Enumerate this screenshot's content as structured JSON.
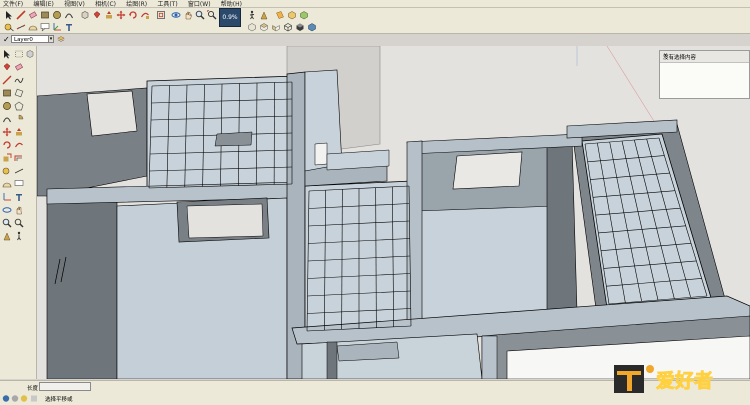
{
  "menu": [
    "文件(F)",
    "编辑(E)",
    "视图(V)",
    "相机(C)",
    "绘图(R)",
    "工具(T)",
    "窗口(W)",
    "帮助(H)"
  ],
  "zoom_badge": "0.9%",
  "layer": {
    "current": "Layer0"
  },
  "tray": {
    "title": "没有选择内容",
    "status": ""
  },
  "measurements": {
    "label": "长度",
    "value": ""
  },
  "status": {
    "message": "选择平移或"
  },
  "watermark": {
    "text": "爱好者"
  },
  "colors": {
    "accent": "#2b4a6b",
    "floor": "#c7d2da",
    "wall": "#a9b4bc",
    "wall_dark": "#6f767b",
    "edge": "#000000",
    "background": "#e4e2de"
  }
}
